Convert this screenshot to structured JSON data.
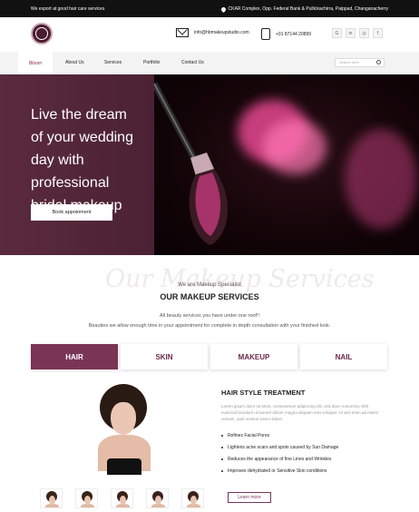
{
  "topbar": {
    "tagline": "We export at good hair care services",
    "address": "CKAR Complex, Opp. Federal Bank & Pullickachirra, Paippad, Changanacherry"
  },
  "header": {
    "email": "info@hbmakeupstudio.com",
    "phone": "+91 87144 20899",
    "socials": [
      "G",
      "in",
      "◎",
      "f"
    ]
  },
  "nav": {
    "logo_text": "Bloom",
    "items": [
      "About Us",
      "Services",
      "Portfolio",
      "Contact Us"
    ],
    "search_placeholder": "Search here"
  },
  "hero": {
    "title": "Live the dream of your wedding day with professional bridal makeup",
    "button": "Book appoinment"
  },
  "services": {
    "script_bg": "Our Makeup Services",
    "subtitle": "We are Makeup Specialist",
    "heading": "OUR MAKEUP SERVICES",
    "desc1": "All beauty services you have under one roof!!",
    "desc2": "Beauties we allow enough time in your appointment for complete in depth consultation with your finished look.",
    "tabs": [
      "HAIR",
      "SKIN",
      "MAKEUP",
      "NAIL"
    ],
    "active_tab": "HAIR"
  },
  "treatment": {
    "title": "HAIR STYLE TREATMENT",
    "lorem": "Lorem ipsum dolor sit amet, consectetuer adipiscing elit, sed diam nonummy nibh euismod tincidunt ut laoreet dolore magna aliquam erat volutpat. Ut wisi enim ad minim veniam, quis nostrud exerci tation.",
    "bullets": [
      "Refines Facial Pores",
      "Lightens acne scars and spots caused by Sun Damage",
      "Reduces the appearance of fine Lines and Wrinkles",
      "Improves dehydrated or Sensitive Skin conditions"
    ],
    "learn_more": "Learn more"
  },
  "colors": {
    "accent": "#7a3456",
    "hero_bg": "#4a1f31",
    "topbar": "#111111"
  }
}
